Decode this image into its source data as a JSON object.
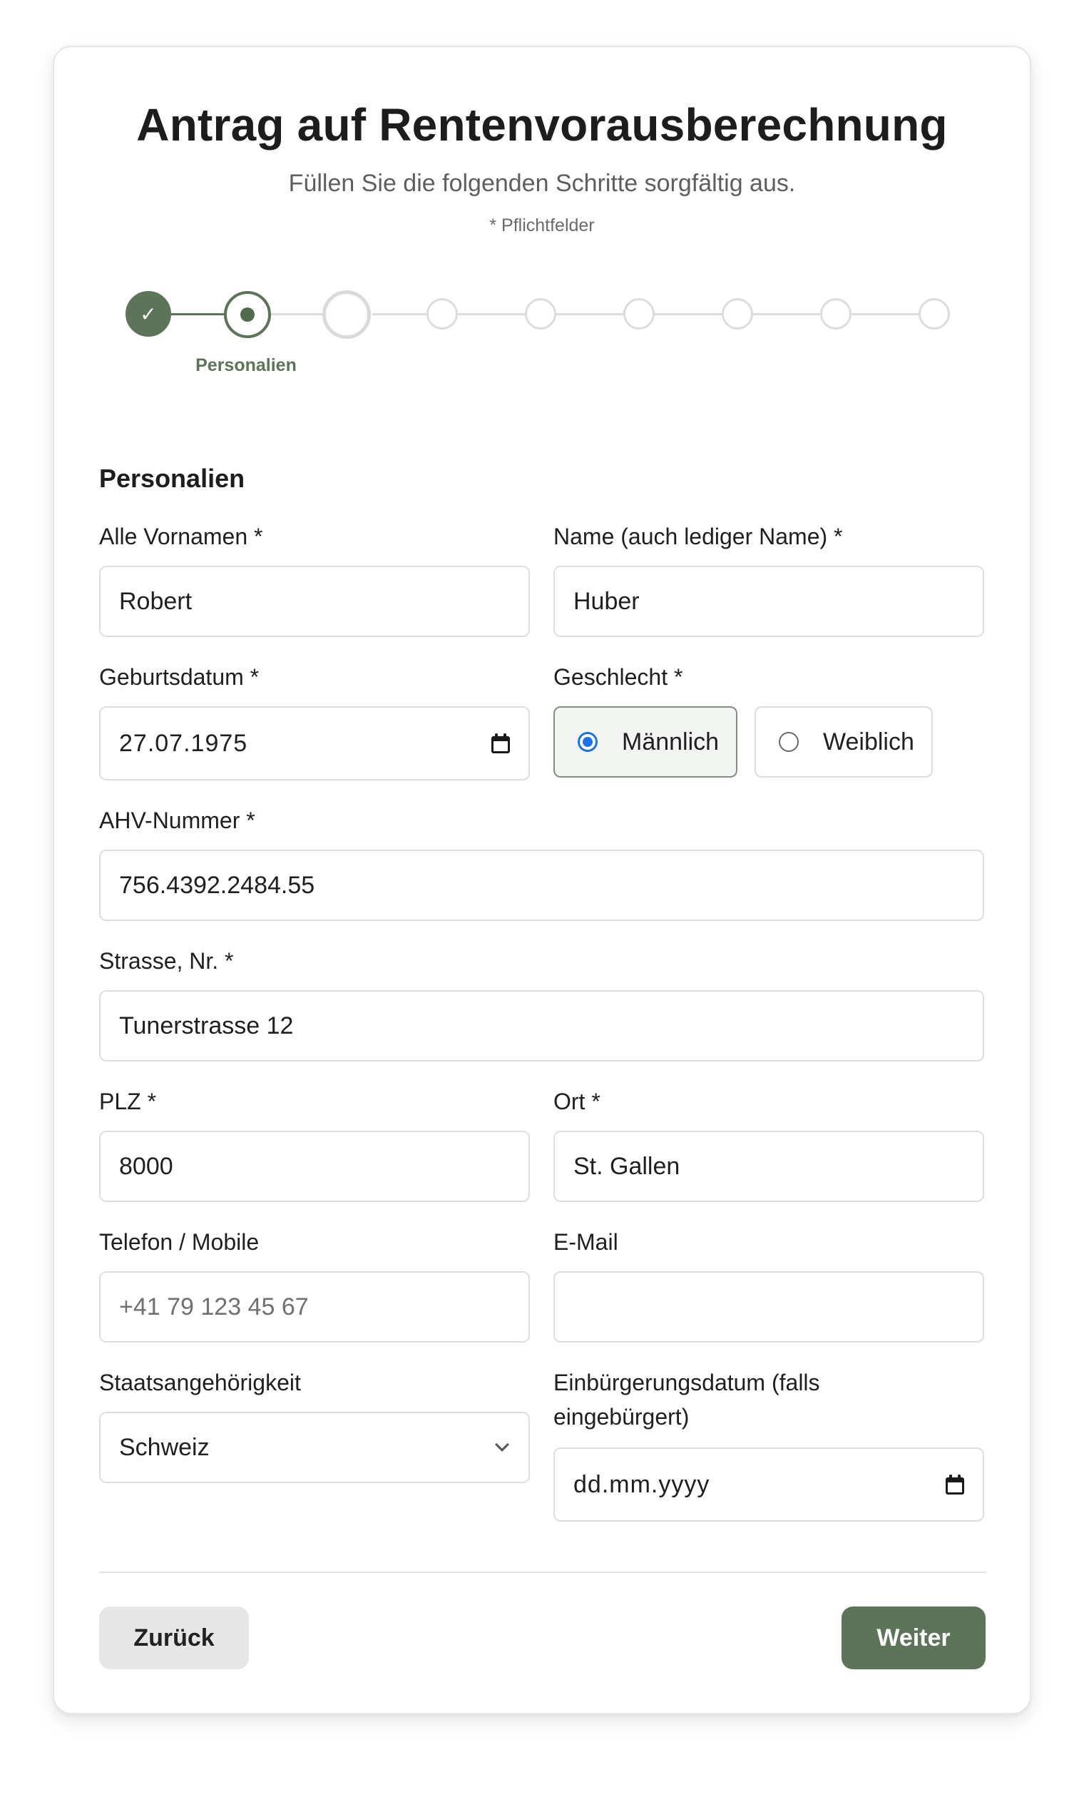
{
  "header": {
    "title": "Antrag auf Rentenvorausberechnung",
    "subtitle": "Füllen Sie die folgenden Schritte sorgfältig aus.",
    "required_note": "* Pflichtfelder"
  },
  "stepper": {
    "current_label": "Personalien",
    "completed_icon": "check-icon"
  },
  "section": {
    "title": "Personalien"
  },
  "fields": {
    "vornamen": {
      "label": "Alle Vornamen *",
      "value": "Robert"
    },
    "name": {
      "label": "Name (auch lediger Name) *",
      "value": "Huber"
    },
    "geburtsdatum": {
      "label": "Geburtsdatum *",
      "value": "27.07.1975"
    },
    "geschlecht": {
      "label": "Geschlecht *",
      "options": [
        "Männlich",
        "Weiblich"
      ],
      "selected": "Männlich"
    },
    "ahv": {
      "label": "AHV-Nummer *",
      "value": "756.4392.2484.55"
    },
    "strasse": {
      "label": "Strasse, Nr. *",
      "value": "Tunerstrasse 12"
    },
    "plz": {
      "label": "PLZ *",
      "value": "8000"
    },
    "ort": {
      "label": "Ort *",
      "value": "St. Gallen"
    },
    "telefon": {
      "label": "Telefon / Mobile",
      "placeholder": "+41 79 123 45 67"
    },
    "email": {
      "label": "E-Mail",
      "value": ""
    },
    "staat": {
      "label": "Staatsangehörigkeit",
      "value": "Schweiz"
    },
    "einbuergerung": {
      "label_line1": "Einbürgerungsdatum (falls",
      "label_line2": "eingebürgert)",
      "placeholder": "dd.mm.yyyy"
    }
  },
  "buttons": {
    "back": "Zurück",
    "next": "Weiter"
  },
  "colors": {
    "accent": "#5c7458",
    "radio": "#1a73e8"
  }
}
